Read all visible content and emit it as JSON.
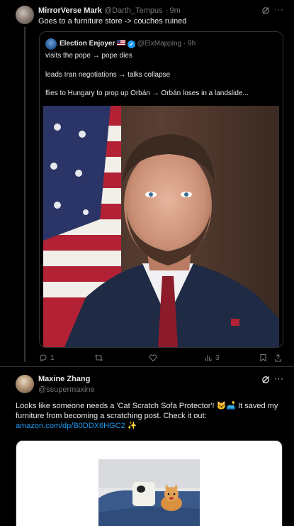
{
  "post1": {
    "author_name": "MirrorVerse Mark",
    "author_handle": "@Darth_Tempus",
    "separator": "·",
    "time": "9m",
    "text": "Goes to a furniture store -> couches ruined",
    "grok_icon": "grok-icon",
    "more_icon": "more-icon"
  },
  "quote": {
    "author_name": "Election Enjoyer",
    "badges": [
      "us-flag-icon",
      "verified-badge-icon"
    ],
    "author_handle": "@ElxMapping",
    "separator": "·",
    "time": "9h",
    "lines": [
      "visits the pope → pope dies",
      "leads Iran negotiations → talks collapse",
      "flies to Hungary to prop up Orbán → Orbán loses in a landslide..."
    ],
    "image": "portrait photo of man in suit in front of American flag"
  },
  "actions": {
    "replies": "1",
    "reposts": "",
    "likes": "",
    "views": "3",
    "icons": [
      "reply-icon",
      "repost-icon",
      "like-icon",
      "views-icon",
      "bookmark-icon",
      "share-icon"
    ]
  },
  "post2": {
    "author_name": "Maxine Zhang",
    "author_handle": "@ssupermaxine",
    "text_main": "Looks like someone needs a 'Cat Scratch Sofa Protector'! 🐱🛋️ It saved my furniture from becoming a scratching post. Check it out:",
    "link": "amazon.com/dp/B0DDX6HGC2",
    "link_suffix": " ✨",
    "grok_icon": "grok-icon",
    "more_icon": "more-icon"
  },
  "card": {
    "image": "cat on a blue sofa cover"
  }
}
